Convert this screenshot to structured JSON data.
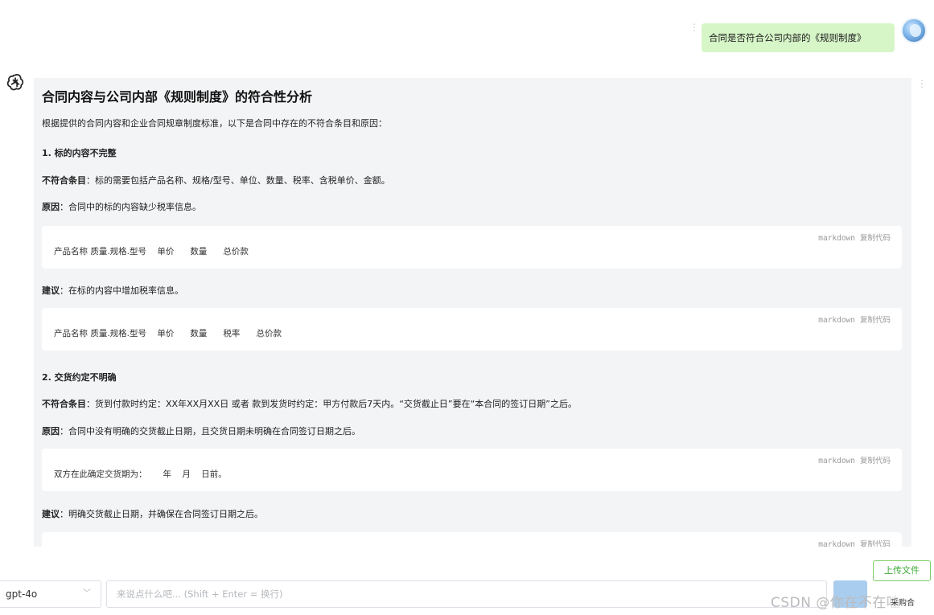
{
  "user_message": {
    "text": "合同是否符合公司内部的《规则制度》"
  },
  "assistant": {
    "title": "合同内容与公司内部《规则制度》的符合性分析",
    "intro": "根据提供的合同内容和企业合同规章制度标准，以下是合同中存在的不符合条目和原因：",
    "sections": [
      {
        "heading": "1. 标的内容不完整",
        "noncompliance_label": "不符合条目",
        "noncompliance_text": "：标的需要包括产品名称、规格/型号、单位、数量、税率、含税单价、金额。",
        "reason_label": "原因",
        "reason_text": "：合同中的标的内容缺少税率信息。",
        "code1": "产品名称 质量.规格.型号    单价      数量      总价款",
        "suggestion_label": "建议",
        "suggestion_text": "：在标的内容中增加税率信息。",
        "code2": "产品名称 质量.规格.型号    单价      数量      税率      总价款"
      },
      {
        "heading": "2. 交货约定不明确",
        "noncompliance_label": "不符合条目",
        "noncompliance_text": "：货到付款时约定：XX年XX月XX日 或者 款到发货时约定：甲方付款后7天内。“交货截止日”要在“本合同的签订日期”之后。",
        "reason_label": "原因",
        "reason_text": "：合同中没有明确的交货截止日期，且交货日期未明确在合同签订日期之后。",
        "code1": "双方在此确定交货期为：      年    月    日前。",
        "suggestion_label": "建议",
        "suggestion_text": "：明确交货截止日期，并确保在合同签订日期之后。",
        "code2": ""
      }
    ],
    "code_lang": "markdown",
    "copy_label": "复制代码"
  },
  "input_bar": {
    "upload_label": "上传文件",
    "model_value": "gpt-4o",
    "placeholder": "来说点什么吧... (Shift + Enter = 换行)",
    "hint": "采购合"
  },
  "watermark": "CSDN @你在不在哇",
  "colors": {
    "user_bubble": "#d7f6c8",
    "card_bg": "#f3f4f6",
    "upload_border": "#7ccf66",
    "send_button": "#a9cdee"
  }
}
